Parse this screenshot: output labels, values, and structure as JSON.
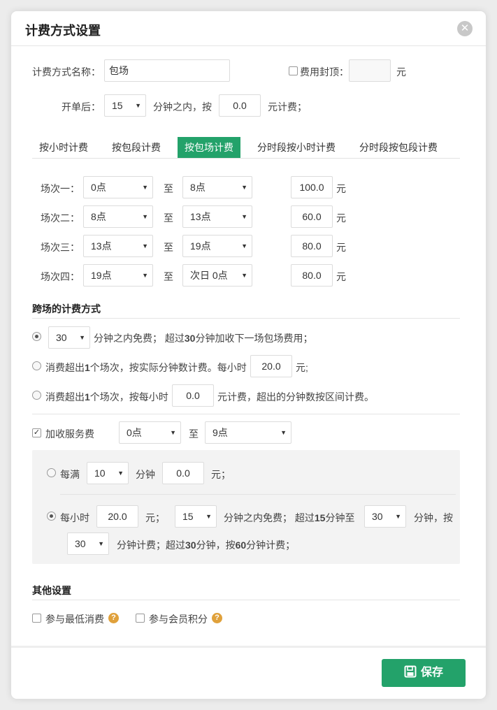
{
  "dialog": {
    "title": "计费方式设置",
    "close_icon": "close-icon"
  },
  "basic": {
    "name_label": "计费方式名称：",
    "name_value": "包场",
    "cap_label": "费用封顶：",
    "cap_value": "",
    "cap_unit": "元",
    "open_label": "开单后：",
    "open_minutes": "15",
    "open_text1": "分钟之内，按",
    "open_price": "0.0",
    "open_text2": "元计费；"
  },
  "tabs": [
    "按小时计费",
    "按包段计费",
    "按包场计费",
    "分时段按小时计费",
    "分时段按包段计费"
  ],
  "active_tab": 2,
  "sessions": [
    {
      "label": "场次一：",
      "from": "0点",
      "to": "8点",
      "sep": "至",
      "price": "100.0",
      "unit": "元"
    },
    {
      "label": "场次二：",
      "from": "8点",
      "to": "13点",
      "sep": "至",
      "price": "60.0",
      "unit": "元"
    },
    {
      "label": "场次三：",
      "from": "13点",
      "to": "19点",
      "sep": "至",
      "price": "80.0",
      "unit": "元"
    },
    {
      "label": "场次四：",
      "from": "19点",
      "to": "次日 0点",
      "sep": "至",
      "price": "80.0",
      "unit": "元"
    }
  ],
  "cross": {
    "title": "跨场的计费方式",
    "opt1_minutes": "30",
    "opt1_text_a": "分钟之内免费；  超过",
    "opt1_bold": "30",
    "opt1_text_b": "分钟加收下一场包场费用；",
    "opt2_text_a": "消费超出",
    "opt2_bold": "1",
    "opt2_text_b": "个场次，按实际分钟数计费。每小时",
    "opt2_price": "20.0",
    "opt2_unit": "元;",
    "opt3_text_a": "消费超出",
    "opt3_bold": "1",
    "opt3_text_b": "个场次，按每小时",
    "opt3_price": "0.0",
    "opt3_text_c": "元计费，超出的分钟数按区间计费。"
  },
  "service": {
    "label": "加收服务费",
    "from": "0点",
    "sep": "至",
    "to": "9点",
    "per_label": "每满",
    "per_minutes": "10",
    "per_unit": "分钟",
    "per_price": "0.0",
    "per_price_unit": "元；",
    "hour_label": "每小时",
    "hour_price": "20.0",
    "hour_price_unit": "元；",
    "free_minutes": "15",
    "free_text_a": "分钟之内免费；  超过",
    "free_bold": "15",
    "free_text_b": "分钟至",
    "upto_minutes": "30",
    "upto_text": "分钟，按",
    "bill_minutes": "30",
    "bill_text_a": "分钟计费；超过",
    "bill_bold1": "30",
    "bill_text_b": "分钟，按",
    "bill_bold2": "60",
    "bill_text_c": "分钟计费；"
  },
  "other": {
    "title": "其他设置",
    "min_spend": "参与最低消费",
    "member_points": "参与会员积分",
    "help_icon": "question-icon"
  },
  "footer": {
    "save_label": "保存",
    "save_icon": "floppy-disk-icon"
  },
  "colors": {
    "accent": "#23a26a",
    "help": "#e0a13b",
    "panel_bg": "#f3f3f3"
  }
}
